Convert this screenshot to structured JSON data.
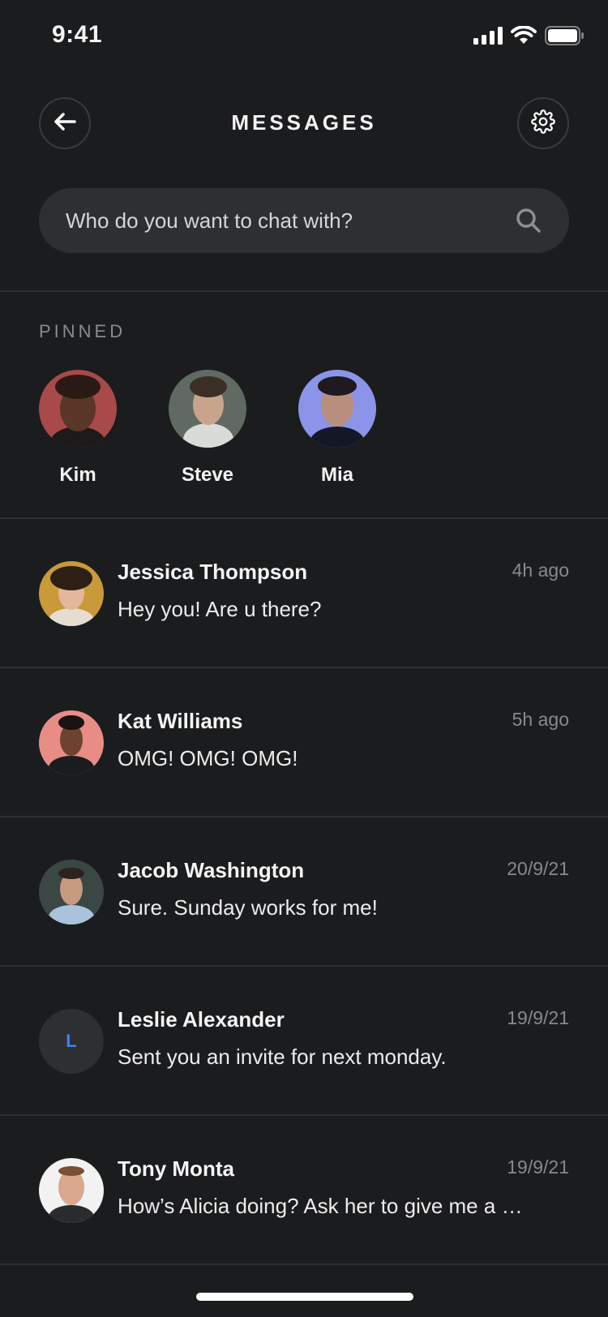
{
  "status_bar": {
    "time": "9:41",
    "icons": [
      "cellular-signal-icon",
      "wifi-icon",
      "battery-icon"
    ]
  },
  "header": {
    "title": "MESSAGES",
    "back_icon": "arrow-left-icon",
    "settings_icon": "gear-icon"
  },
  "search": {
    "placeholder": "Who do you want to chat with?",
    "icon": "search-icon"
  },
  "pinned": {
    "label": "PINNED",
    "items": [
      {
        "name": "Kim"
      },
      {
        "name": "Steve"
      },
      {
        "name": "Mia"
      }
    ]
  },
  "conversations": [
    {
      "name": "Jessica Thompson",
      "message": "Hey you! Are u there?",
      "time": "4h ago"
    },
    {
      "name": "Kat Williams",
      "message": "OMG! OMG! OMG!",
      "time": "5h ago"
    },
    {
      "name": "Jacob Washington",
      "message": "Sure. Sunday works for me!",
      "time": "20/9/21"
    },
    {
      "name": "Leslie Alexander",
      "message": "Sent you an invite for next monday.",
      "time": "19/9/21",
      "initial": "L"
    },
    {
      "name": "Tony Monta",
      "message": "How’s Alicia doing? Ask her to give me a call!",
      "time": "19/9/21"
    }
  ],
  "colors": {
    "background": "#1b1c1e",
    "surface": "#2e2f32",
    "accent": "#3b82f6",
    "muted": "#88898c"
  }
}
